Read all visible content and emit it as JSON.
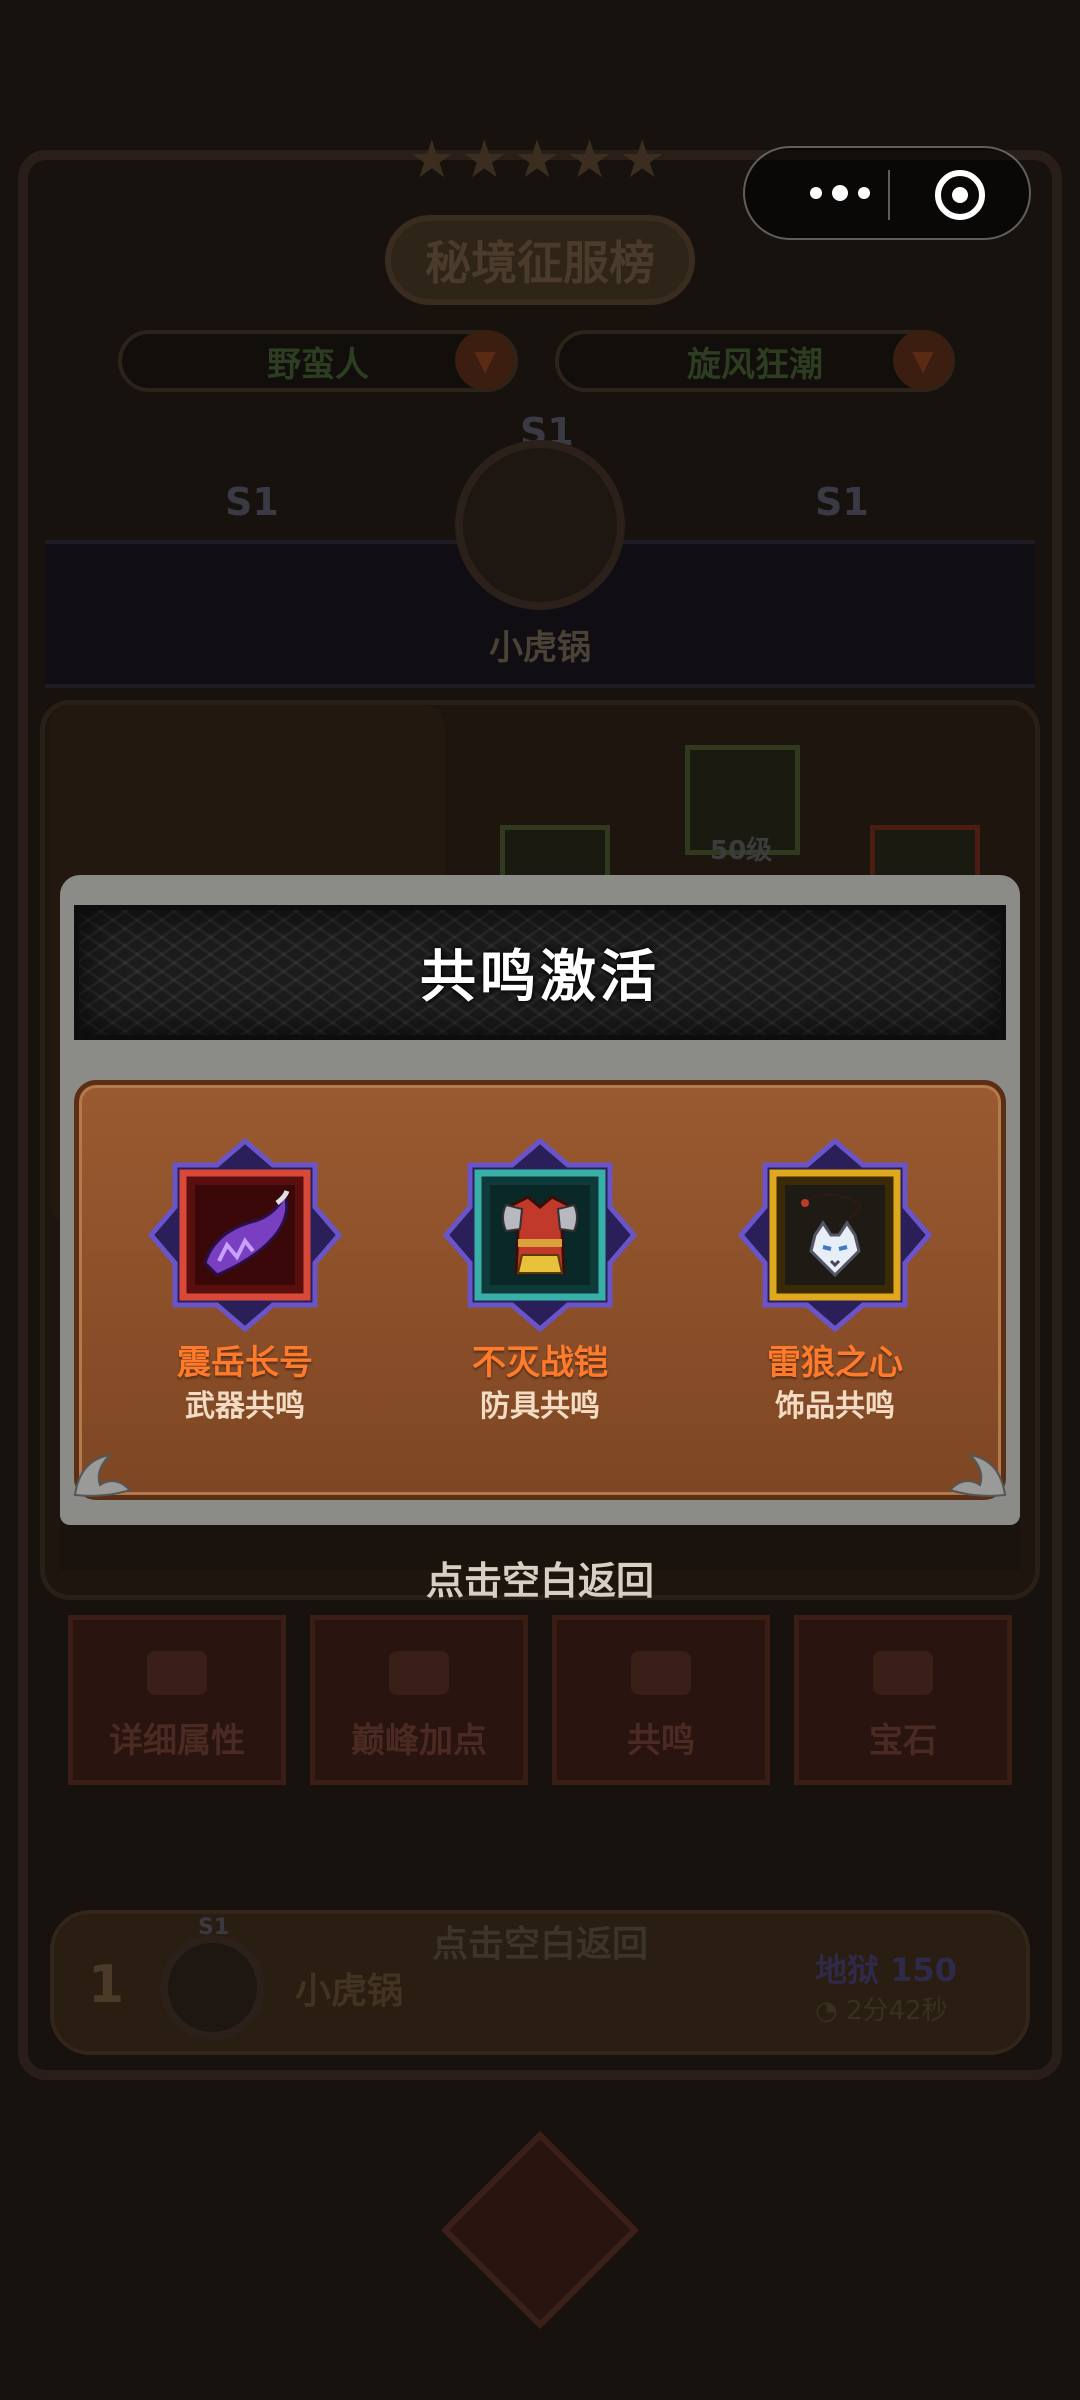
{
  "background": {
    "title": "秘境征服榜",
    "class_filter": "野蛮人",
    "mode_filter": "旋风狂潮",
    "season_badge": "S1",
    "player_name": "小虎锅",
    "equip_level": "50级",
    "function_buttons": [
      {
        "label": "详细属性",
        "icon": "list-icon"
      },
      {
        "label": "巅峰加点",
        "icon": "house-icon"
      },
      {
        "label": "共鸣",
        "icon": "resonance-icon"
      },
      {
        "label": "宝石",
        "icon": "gem-icon"
      }
    ],
    "ghost_return_text": "点击空白返回",
    "ranking": {
      "rank": "1",
      "season": "S1",
      "name": "小虎锅",
      "level": "地狱 150",
      "time": "2分42秒"
    }
  },
  "capsule": {
    "menu_icon": "more-dots-icon",
    "close_icon": "target-close-icon"
  },
  "modal": {
    "title": "共鸣激活",
    "items": [
      {
        "name": "震岳长号",
        "type": "武器共鸣",
        "frame_color": "#c0392b",
        "icon": "horn-icon"
      },
      {
        "name": "不灭战铠",
        "type": "防具共鸣",
        "frame_color": "#2e9c9c",
        "icon": "armor-icon"
      },
      {
        "name": "雷狼之心",
        "type": "饰品共鸣",
        "frame_color": "#d4a017",
        "icon": "wolf-amulet-icon"
      }
    ],
    "name_color": "#ff7a2a",
    "return_text": "点击空白返回"
  }
}
